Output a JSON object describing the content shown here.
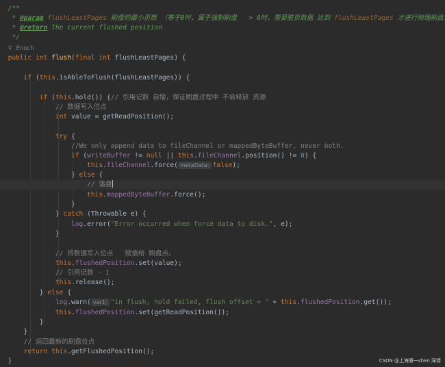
{
  "javadoc": {
    "open": "/**",
    "star": " *",
    "param_tag": "@param",
    "param_name": "flushLeastPages",
    "param_desc": " 刷盘的最小页数 （等于0时，属于强制刷盘   > 0时，需要脏页数据 达到 ",
    "param_ref": "flushLeastPages",
    "param_tail": " 才进行物理刷盘）",
    "return_tag": "@return",
    "return_desc": " The current flushed position",
    "close": " */"
  },
  "author": "Enoch",
  "hints": {
    "metadata": "metaData:",
    "var1": "var1:"
  },
  "code": {
    "l_sig_public": "public",
    "l_sig_int": "int",
    "l_sig_flush": "flush",
    "l_sig_final": "final",
    "l_sig_param_int": "int",
    "l_sig_param": "flushLeastPages",
    "l_if1_a": "if",
    "l_if1_this": "this",
    "l_if1_b": ".isAbleToFlush(flushLeastPages)) {",
    "l_if2_a": "if",
    "l_if2_this": "this",
    "l_if2_b": ".hold()) {",
    "l_if2_comment": "// 引用记数 自增，保证刷盘过程中 不会释放 资源",
    "l_comment_write": "// 数据写入位点",
    "l_value_int": "int",
    "l_value_rest": " value = getReadPosition();",
    "l_try": "try",
    "l_comment_only": "//We only append data to fileChannel or mappedByteBuffer, never both.",
    "l_if3_if": "if",
    "l_if3_wb": "writeBuffer",
    "l_if3_ne": " != ",
    "l_if3_null": "null",
    "l_if3_or": " || ",
    "l_if3_this": "this",
    "l_if3_fc": "fileChannel",
    "l_if3_pos": ".position() != ",
    "l_if3_zero": "0",
    "l_if3_end": ") {",
    "l_force_this": "this",
    "l_force_fc": "fileChannel",
    "l_force_call": ".force(",
    "l_force_false": "false",
    "l_force_end": ");",
    "l_else": "else",
    "l_comment_luopan": "// 落盘",
    "l_mbb_this": "this",
    "l_mbb_field": "mappedByteBuffer",
    "l_mbb_call": ".force();",
    "l_catch": "catch",
    "l_catch_rest": " (Throwable e) {",
    "l_log_field": "log",
    "l_log_call": ".error(",
    "l_log_str": "\"Error occurred when force data to disk.\"",
    "l_log_end": ", e);",
    "l_comment_assign": "// 将数据写入位点   赋值给 刷盘点。",
    "l_set_this": "this",
    "l_set_field": "flushedPosition",
    "l_set_call": ".set(value);",
    "l_comment_ref": "// 引用记数 - 1",
    "l_release_this": "this",
    "l_release_call": ".release();",
    "l_else2": "else",
    "l_warn_field": "log",
    "l_warn_call": ".warn(",
    "l_warn_str": "\"in flush, hold failed, flush offset = \"",
    "l_warn_plus": " + ",
    "l_warn_this": "this",
    "l_warn_fp": "flushedPosition",
    "l_warn_end": ".get());",
    "l_set2_this": "this",
    "l_set2_field": "flushedPosition",
    "l_set2_call": ".set(getReadPosition());",
    "l_comment_return": "// 返回最新的刷盘位点",
    "l_return": "return",
    "l_return_this": "this",
    "l_return_call": ".getFlushedPosition();"
  },
  "watermark": "CSDN @上海第一shen 深情",
  "colors": {
    "background": "#2b2b2b",
    "keyword": "#cc7832",
    "function": "#ffc66d",
    "field": "#9876aa",
    "string": "#6a8759",
    "number": "#6897bb",
    "comment": "#808080",
    "doc": "#629755"
  }
}
